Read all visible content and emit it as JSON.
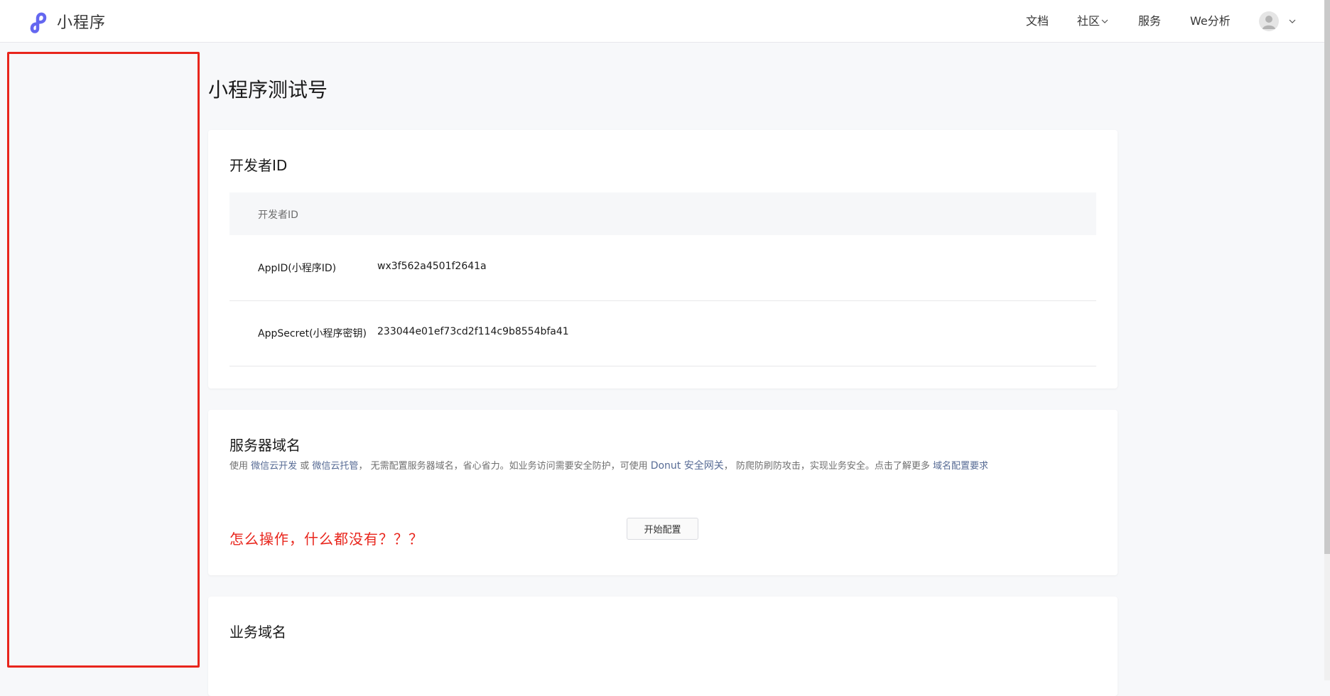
{
  "header": {
    "brand_name": "小程序",
    "nav": {
      "docs": "文档",
      "community": "社区",
      "service": "服务",
      "analytics": "We分析"
    }
  },
  "page": {
    "title": "小程序测试号"
  },
  "developer_id": {
    "title": "开发者ID",
    "table_header": "开发者ID",
    "rows": [
      {
        "key": "AppID(小程序ID)",
        "value": "wx3f562a4501f2641a"
      },
      {
        "key": "AppSecret(小程序密钥)",
        "value": "233044e01ef73cd2f114c9b8554bfa41"
      }
    ]
  },
  "server_domain": {
    "title": "服务器域名",
    "desc": {
      "p1": "使用 ",
      "link1": "微信云开发",
      "p2": " 或 ",
      "link2": "微信云托管",
      "p3": "， 无需配置服务器域名，省心省力。如业务访问需要安全防护，可使用 ",
      "link3": "Donut 安全网关",
      "p4": "， 防爬防刷防攻击，实现业务安全。点击了解更多 ",
      "link4": "域名配置要求"
    },
    "annotation": "怎么操作，什么都没有？？？",
    "config_button": "开始配置"
  },
  "business_domain": {
    "title": "业务域名"
  },
  "colors": {
    "accent_link": "#576b95",
    "annotation_red": "#e8251c",
    "brand_logo": "#6467f0"
  }
}
